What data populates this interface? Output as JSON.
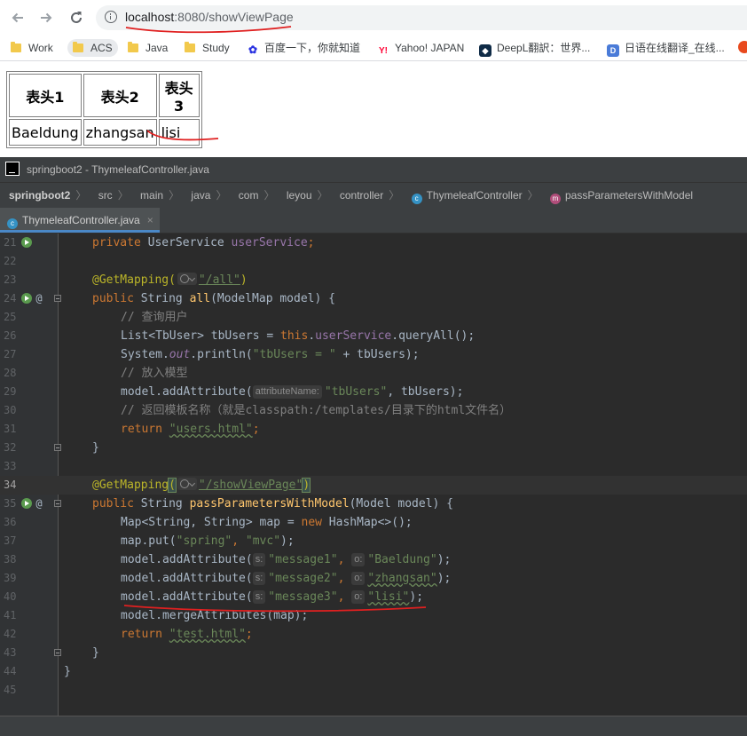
{
  "browser": {
    "url_host": "localhost",
    "url_rest": ":8080/showViewPage",
    "bookmarks": [
      {
        "label": "Work",
        "type": "folder"
      },
      {
        "label": "ACS",
        "type": "folder"
      },
      {
        "label": "Java",
        "type": "folder"
      },
      {
        "label": "Study",
        "type": "folder"
      },
      {
        "label": "百度一下，你就知道",
        "type": "baidu"
      },
      {
        "label": "Yahoo! JAPAN",
        "type": "yahoo"
      },
      {
        "label": "DeepL翻訳：世界...",
        "type": "deepl"
      },
      {
        "label": "日语在线翻译_在线...",
        "type": "dict"
      }
    ]
  },
  "table": {
    "headers": [
      "表头1",
      "表头2",
      "表头3"
    ],
    "rows": [
      [
        "Baeldung",
        "zhangsan",
        "lisi"
      ]
    ]
  },
  "ide": {
    "title": "springboot2 - ThymeleafController.java",
    "breadcrumb": [
      "springboot2",
      "src",
      "main",
      "java",
      "com",
      "leyou",
      "controller",
      "ThymeleafController",
      "passParametersWithModel"
    ],
    "tab": "ThymeleafController.java",
    "current_line": "34",
    "lines": [
      {
        "n": "21"
      },
      {
        "n": "22"
      },
      {
        "n": "23"
      },
      {
        "n": "24"
      },
      {
        "n": "25"
      },
      {
        "n": "26"
      },
      {
        "n": "27"
      },
      {
        "n": "28"
      },
      {
        "n": "29"
      },
      {
        "n": "30"
      },
      {
        "n": "31"
      },
      {
        "n": "32"
      },
      {
        "n": "33"
      },
      {
        "n": "34"
      },
      {
        "n": "35"
      },
      {
        "n": "36"
      },
      {
        "n": "37"
      },
      {
        "n": "38"
      },
      {
        "n": "39"
      },
      {
        "n": "40"
      },
      {
        "n": "41"
      },
      {
        "n": "42"
      },
      {
        "n": "43"
      },
      {
        "n": "44"
      },
      {
        "n": "45"
      }
    ],
    "code": {
      "l21_kw": "private",
      "l21_type": " UserService ",
      "l21_field": "userService",
      "l21_end": ";",
      "l23_ann": "@GetMapping(",
      "l23_str": "\"/all\"",
      "l23_end": ")",
      "l24_kw": "public",
      "l24_a": " String ",
      "l24_m": "all",
      "l24_b": "(ModelMap model) {",
      "l25_c": "// 查询用户",
      "l26_a": "List<TbUser> tbUsers = ",
      "l26_kw": "this",
      "l26_dot": ".",
      "l26_field": "userService",
      "l26_b": ".queryAll();",
      "l27_a": "System.",
      "l27_static": "out",
      "l27_b": ".println(",
      "l27_str": "\"tbUsers = \"",
      "l27_c": " + tbUsers);",
      "l28_c": "// 放入模型",
      "l29_a": "model.addAttribute(",
      "l29_hint": "attributeName:",
      "l29_str": "\"tbUsers\"",
      "l29_b": ", tbUsers);",
      "l30_c": "// 返回模板名称（就是classpath:/templates/目录下的html文件名）",
      "l31_kw": "return",
      "l31_str": "\"users.html\"",
      "l31_end": ";",
      "l32": "}",
      "l34_ann": "@GetMapping",
      "l34_paren": "(",
      "l34_str": "\"/showViewPage\"",
      "l34_end": ")",
      "l35_kw": "public",
      "l35_a": " String ",
      "l35_m": "passParametersWithModel",
      "l35_b": "(Model model) {",
      "l36_a": "Map<String, String> map = ",
      "l36_kw": "new",
      "l36_b": " HashMap<>();",
      "l37_a": "map.put(",
      "l37_s1": "\"spring\"",
      "l37_sep": ", ",
      "l37_s2": "\"mvc\"",
      "l37_end": ");",
      "l38_a": "model.addAttribute(",
      "l38_h1": "s:",
      "l38_s1": "\"message1\"",
      "l38_sep": ", ",
      "l38_h2": "o:",
      "l38_s2": "\"Baeldung\"",
      "l38_end": ");",
      "l39_a": "model.addAttribute(",
      "l39_h1": "s:",
      "l39_s1": "\"message2\"",
      "l39_sep": ", ",
      "l39_h2": "o:",
      "l39_s2": "\"zhangsan\"",
      "l39_end": ");",
      "l40_a": "model.addAttribute(",
      "l40_h1": "s:",
      "l40_s1": "\"message3\"",
      "l40_sep": ", ",
      "l40_h2": "o:",
      "l40_s2": "\"lisi\"",
      "l40_end": ");",
      "l41": "model.mergeAttributes(map);",
      "l42_kw": "return",
      "l42_str": "\"test.html\"",
      "l42_end": ";",
      "l43": "}",
      "l44": "}"
    }
  }
}
